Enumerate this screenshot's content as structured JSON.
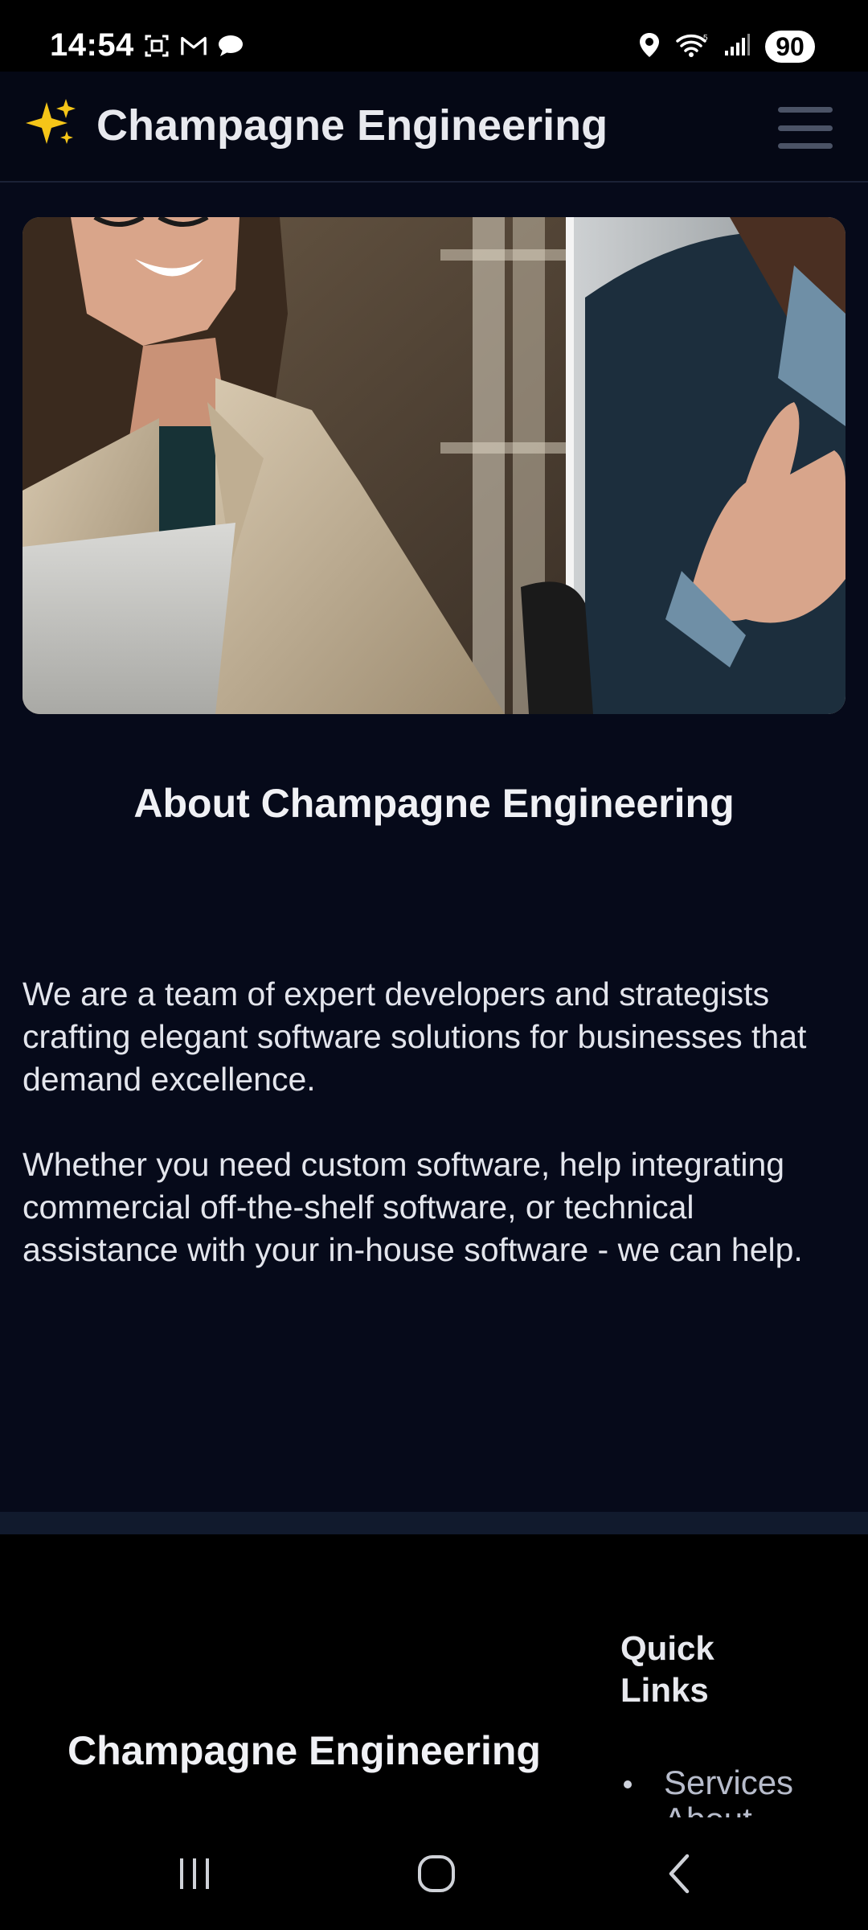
{
  "status_bar": {
    "time": "14:54",
    "battery": "90",
    "icons": [
      "screenshot-icon",
      "gmail-icon",
      "chat-bubble-icon",
      "location-icon",
      "wifi-icon",
      "signal-icon"
    ]
  },
  "header": {
    "title": "Champagne Engineering",
    "logo_icon": "sparkles-icon",
    "menu_icon": "hamburger-menu-icon"
  },
  "hero": {
    "image": "photo of two business people in an office meeting"
  },
  "about": {
    "title": "About Champagne Engineering",
    "paragraph_1": "We are a team of expert developers and strategists crafting elegant software solutions for businesses that demand excellence.",
    "paragraph_2": "Whether you need custom software, help integrating commercial off-the-shelf software, or technical assistance with your in-house software - we can help."
  },
  "footer": {
    "brand": "Champagne Engineering",
    "quick_links_title": "Quick Links",
    "links": [
      "Services",
      "About"
    ]
  },
  "nav_bar": {
    "icons": [
      "recent-apps-icon",
      "home-icon",
      "back-icon"
    ]
  },
  "colors": {
    "background": "#060a1a",
    "header_bg": "#050815",
    "footer_bg": "#000000",
    "band": "#111a2d",
    "text": "#e3e5ec"
  }
}
